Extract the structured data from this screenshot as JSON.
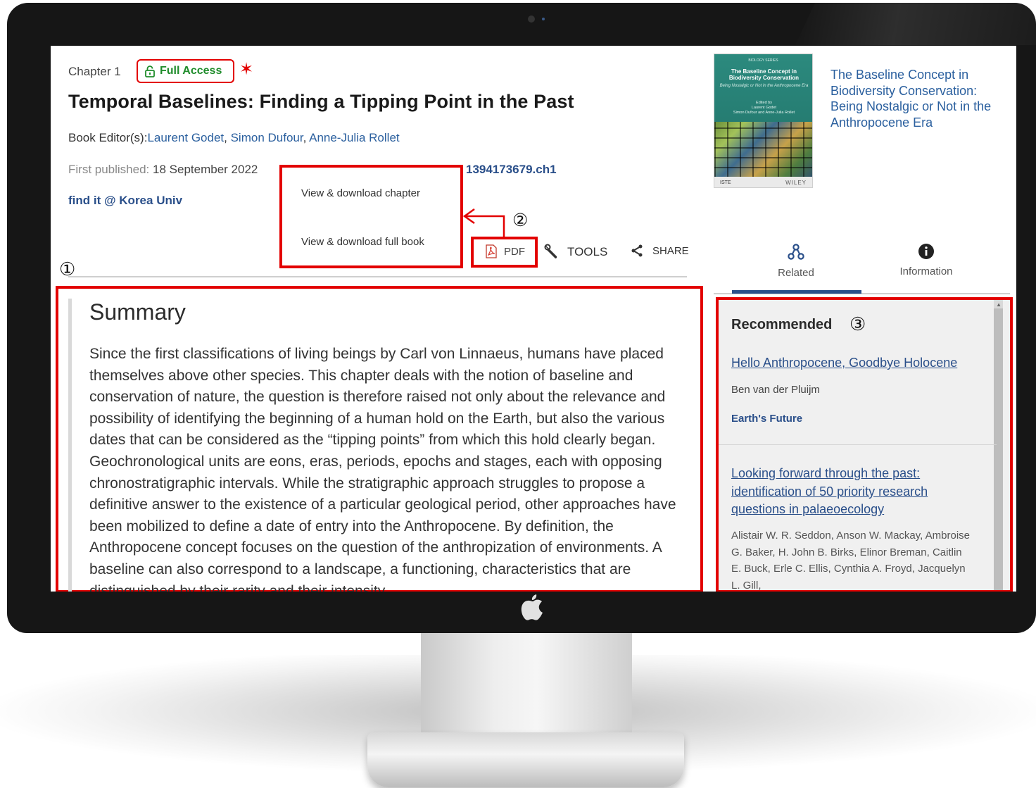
{
  "chapter": {
    "label": "Chapter 1",
    "access_badge": "Full Access",
    "title": "Temporal Baselines: Finding a Tipping Point in the Past",
    "editors_label": "Book Editor(s):",
    "editors": [
      "Laurent Godet",
      "Simon Dufour",
      "Anne-Julia Rollet"
    ],
    "first_published_label": "First published:",
    "first_published_date": "18 September 2022",
    "doi_partial": "1394173679.ch1",
    "find_it": "find it @ Korea Univ"
  },
  "pdf_menu": {
    "items": [
      "View & download chapter",
      "View & download full book"
    ]
  },
  "toolbar": {
    "pdf_label": "PDF",
    "tools_label": "TOOLS",
    "share_label": "SHARE"
  },
  "annotations": {
    "marker_1": "①",
    "marker_2": "②",
    "marker_3": "③",
    "star": "✶"
  },
  "summary": {
    "heading": "Summary",
    "text": "Since the first classifications of living beings by Carl von Linnaeus, humans have placed themselves above other species. This chapter deals with the notion of baseline and conservation of nature, the question is therefore raised not only about the relevance and possibility of identifying the beginning of a human hold on the Earth, but also the various dates that can be considered as the “tipping points” from which this hold clearly began. Geochronological units are eons, eras, periods, epochs and stages, each with opposing chronostratigraphic intervals. While the stratigraphic approach struggles to propose a definitive answer to the existence of a particular geological period, other approaches have been mobilized to define a date of entry into the Anthropocene. By definition, the Anthropocene concept focuses on the question of the anthropization of environments. A baseline can also correspond to a landscape, a functioning, characteristics that are distinguished by their rarity and their intensity."
  },
  "book": {
    "title": "The Baseline Concept in Biodiversity Conservation: Being Nostalgic or Not in the Anthropocene Era",
    "cover": {
      "series": "BIOLOGY SERIES",
      "title": "The Baseline Concept in Biodiversity Conservation",
      "subtitle": "Being Nostalgic or Not in the Anthropocene Era",
      "edited_by": "Edited by",
      "editors": "Laurent Godet\nSimon Dufour and Anne-Julia Rollet",
      "imprint": "ISTE",
      "publisher": "WILEY"
    }
  },
  "sidebar_tabs": {
    "related": "Related",
    "information": "Information",
    "active": "related"
  },
  "recommended": {
    "heading": "Recommended",
    "items": [
      {
        "title": "Hello Anthropocene, Goodbye Holocene",
        "authors": "Ben van der Pluijm",
        "journal": "Earth's Future"
      },
      {
        "title": "Looking forward through the past: identification of 50 priority research questions in palaeoecology",
        "authors": "Alistair W. R. Seddon, Anson W. Mackay, Ambroise G. Baker, H. John B. Birks, Elinor Breman, Caitlin E. Buck, Erle C. Ellis, Cynthia A. Froyd, Jacquelyn L. Gill,"
      }
    ]
  },
  "colors": {
    "annotation_red": "#e30000",
    "link_blue": "#2a5f9e",
    "dark_blue": "#2a4f8a",
    "access_green": "#1f8c2b",
    "cover_teal": "#2c8a7e"
  },
  "icons": {
    "lock": "lock-icon",
    "pdf": "pdf-file-icon",
    "tools": "wrench-icon",
    "share": "share-icon",
    "related": "related-nodes-icon",
    "information": "info-icon",
    "apple": "apple-logo-icon"
  }
}
